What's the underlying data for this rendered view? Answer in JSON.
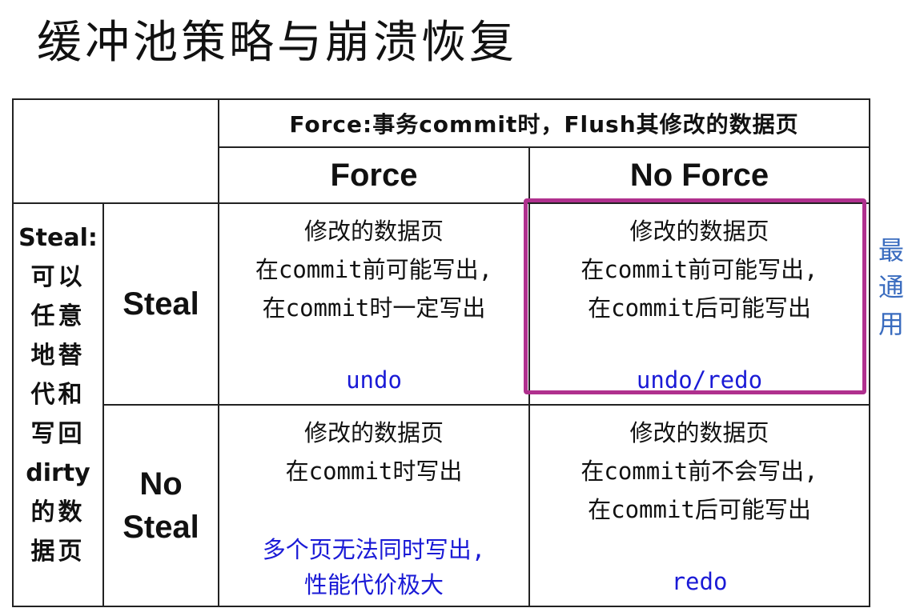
{
  "title": "缓冲池策略与崩溃恢复",
  "header": {
    "force_definition": "Force:事务commit时，Flush其修改的数据页",
    "force_label": "Force",
    "no_force_label": "No Force"
  },
  "steal_definition": {
    "label": "Steal:",
    "lines": [
      "可以",
      "任意",
      "地替",
      "代和",
      "写回"
    ],
    "dirty": "dirty",
    "tail": [
      "的数",
      "据页"
    ]
  },
  "rows": {
    "steal_label": "Steal",
    "no_steal_label_1": "No",
    "no_steal_label_2": "Steal"
  },
  "cells": {
    "steal_force": {
      "lines": [
        "修改的数据页",
        "在commit前可能写出,",
        "在commit时一定写出"
      ],
      "note": "undo"
    },
    "steal_no_force": {
      "lines": [
        "修改的数据页",
        "在commit前可能写出,",
        "在commit后可能写出"
      ],
      "note": "undo/redo"
    },
    "no_steal_force": {
      "lines": [
        "修改的数据页",
        "在commit时写出"
      ],
      "note_lines": [
        "多个页无法同时写出,",
        "性能代价极大"
      ]
    },
    "no_steal_no_force": {
      "lines": [
        "修改的数据页",
        "在commit前不会写出,",
        "在commit后可能写出"
      ],
      "note": "redo"
    }
  },
  "side_note": [
    "最",
    "通",
    "用"
  ],
  "colors": {
    "highlight": "#b0308e",
    "note_text": "#1a1ad6",
    "side_note_text": "#3a6cbf"
  }
}
